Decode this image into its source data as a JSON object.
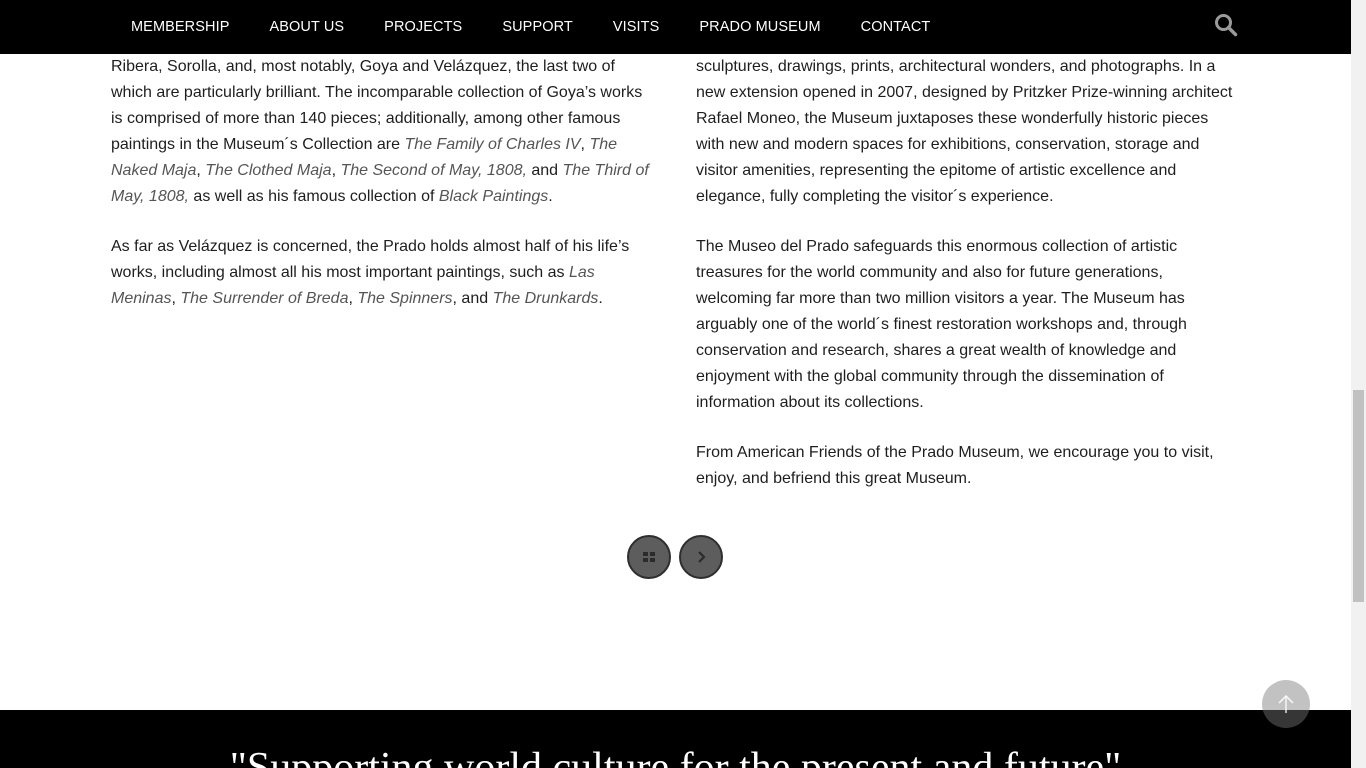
{
  "nav": {
    "items": [
      "MEMBERSHIP",
      "ABOUT US",
      "PROJECTS",
      "SUPPORT",
      "VISITS",
      "PRADO MUSEUM",
      "CONTACT"
    ],
    "search_icon": "search-icon"
  },
  "left_column": {
    "p1": [
      {
        "t": "century with principal works of artists such as El Greco, Murillo, Zurbarán, Ribera, Sorolla, and, most notably, Goya and Velázquez, the last two of which are particularly brilliant. The incomparable collection of Goya’s works is comprised of more than 140 pieces; additionally, among other famous paintings in the Museum´s Collection are "
      },
      {
        "t": "The Family of Charles IV",
        "i": true
      },
      {
        "t": ", "
      },
      {
        "t": "The Naked Maja",
        "i": true
      },
      {
        "t": ", "
      },
      {
        "t": "The Clothed Maja",
        "i": true
      },
      {
        "t": ", "
      },
      {
        "t": "The Second of May, 1808,",
        "i": true
      },
      {
        "t": " and "
      },
      {
        "t": "The Third of May, 1808,",
        "i": true
      },
      {
        "t": " as well as his famous collection of "
      },
      {
        "t": "Black Paintings",
        "i": true
      },
      {
        "t": "."
      }
    ],
    "p2": [
      {
        "t": "As far as Velázquez is concerned, the Prado holds almost half of his life’s works, including almost all his most important paintings, such as "
      },
      {
        "t": "Las Meninas",
        "i": true
      },
      {
        "t": ", "
      },
      {
        "t": "The Surrender of Breda",
        "i": true
      },
      {
        "t": ", "
      },
      {
        "t": "The Spinners",
        "i": true
      },
      {
        "t": ", and "
      },
      {
        "t": "The Drunkards",
        "i": true
      },
      {
        "t": "."
      }
    ]
  },
  "right_column": {
    "p1": "donation, and acquisition of works. The Museum also holds timeless sculptures, drawings, prints, architectural wonders, and photographs. In a new extension opened in 2007, designed by Pritzker Prize-winning architect Rafael Moneo, the Museum juxtaposes these wonderfully historic pieces with new and modern spaces for exhibitions, conservation, storage and visitor amenities, representing the epitome of artistic excellence and elegance, fully completing the visitor´s experience.",
    "p2": "The Museo del Prado safeguards this enormous collection of artistic treasures for the world community and also for future generations, welcoming far more than two million visitors a year.  The Museum has arguably one of the world´s finest restoration workshops and, through conservation and research, shares a great wealth of knowledge and enjoyment with the global community through the dissemination of information about its collections.",
    "p3": "From American Friends of the Prado Museum, we encourage you to visit, enjoy, and befriend this great Museum."
  },
  "buttons": {
    "grid_icon": "grid-icon",
    "next_icon": "chevron-right-icon",
    "top_icon": "arrow-up-icon"
  },
  "footer": {
    "tagline": "\"Supporting world culture for the present and future\""
  }
}
